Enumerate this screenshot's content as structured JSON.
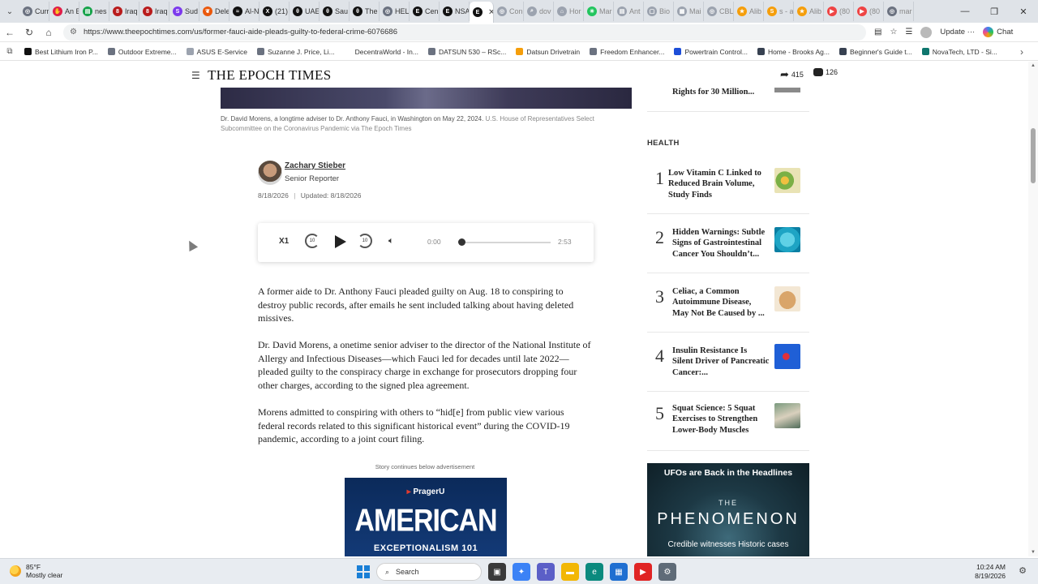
{
  "browser": {
    "tabs": [
      {
        "label": "Curr",
        "color": "#6b7280",
        "glyph": "◎"
      },
      {
        "label": "An E",
        "color": "#e11d48",
        "glyph": "✋"
      },
      {
        "label": "nes",
        "color": "#16a34a",
        "glyph": "▤"
      },
      {
        "label": "Iraq",
        "color": "#b91c1c",
        "glyph": "8"
      },
      {
        "label": "Iraq",
        "color": "#b91c1c",
        "glyph": "8"
      },
      {
        "label": "Sud",
        "color": "#7c3aed",
        "glyph": "S"
      },
      {
        "label": "Dele",
        "color": "#ea580c",
        "glyph": "❦"
      },
      {
        "label": "Al-N",
        "color": "#111111",
        "glyph": "≈"
      },
      {
        "label": "(21)",
        "color": "#111111",
        "glyph": "X"
      },
      {
        "label": "UAE",
        "color": "#111111",
        "glyph": "θ"
      },
      {
        "label": "Sau",
        "color": "#111111",
        "glyph": "θ"
      },
      {
        "label": "The",
        "color": "#111111",
        "glyph": "θ"
      },
      {
        "label": "HEL",
        "color": "#6b7280",
        "glyph": "◎"
      },
      {
        "label": "Cen",
        "color": "#111111",
        "glyph": "E"
      },
      {
        "label": "NSA",
        "color": "#111111",
        "glyph": "E"
      }
    ],
    "active_tab_glyph": "E",
    "dim_tabs": [
      {
        "label": "Con",
        "color": "#9ca3af",
        "glyph": "◎"
      },
      {
        "label": "dov",
        "color": "#9ca3af",
        "glyph": "⌕"
      },
      {
        "label": "Hor",
        "color": "#9ca3af",
        "glyph": "⌂"
      },
      {
        "label": "Mar",
        "color": "#22c55e",
        "glyph": "✳"
      },
      {
        "label": "Ant",
        "color": "#9ca3af",
        "glyph": "▤"
      },
      {
        "label": "Bio",
        "color": "#9ca3af",
        "glyph": "▢"
      },
      {
        "label": "Mai",
        "color": "#9ca3af",
        "glyph": "▦"
      },
      {
        "label": "CBL",
        "color": "#9ca3af",
        "glyph": "◎"
      },
      {
        "label": "Alib",
        "color": "#f59e0b",
        "glyph": "★"
      },
      {
        "label": "s - a",
        "color": "#f59e0b",
        "glyph": "S"
      },
      {
        "label": "Alib",
        "color": "#f59e0b",
        "glyph": "★"
      },
      {
        "label": "(80",
        "color": "#ef4444",
        "glyph": "▶"
      },
      {
        "label": "(80",
        "color": "#ef4444",
        "glyph": "▶"
      },
      {
        "label": "mar",
        "color": "#6b7280",
        "glyph": "◎"
      }
    ],
    "tab_close": "✕",
    "new_tab": "+",
    "url": "https://www.theepochtimes.com/us/former-fauci-aide-pleads-guilty-to-federal-crime-6076686",
    "update_label": "Update",
    "chat_label": "Chat",
    "bookmarks": [
      {
        "label": "Best Lithium Iron P...",
        "color": "#111111"
      },
      {
        "label": "Outdoor Extreme...",
        "color": "#6b7280"
      },
      {
        "label": "ASUS E-Service",
        "color": "#9ca3af"
      },
      {
        "label": "Suzanne J. Price, Li...",
        "color": "#6b7280"
      },
      {
        "label": "DecentraWorld - In...",
        "color": "#ffffff"
      },
      {
        "label": "DATSUN 530 – RSc...",
        "color": "#6b7280"
      },
      {
        "label": "Datsun Drivetrain",
        "color": "#f59e0b"
      },
      {
        "label": "Freedom Enhancer...",
        "color": "#6b7280"
      },
      {
        "label": "Powertrain Control...",
        "color": "#1d4ed8"
      },
      {
        "label": "Home - Brooks Ag...",
        "color": "#374151"
      },
      {
        "label": "Beginner's Guide t...",
        "color": "#374151"
      },
      {
        "label": "NovaTech, LTD - Si...",
        "color": "#0f766e"
      }
    ]
  },
  "header": {
    "logo": "THE EPOCH TIMES",
    "share_count": "415",
    "comment_count": "126"
  },
  "article": {
    "caption": "Dr. David Morens, a longtime adviser to Dr. Anthony Fauci, in Washington on May 22, 2024.",
    "caption_credit": "U.S. House of Representatives Select Subcommittee on the Coronavirus Pandemic via The Epoch Times",
    "author_name": "Zachary Stieber",
    "author_role": "Senior Reporter",
    "date_published": "8/18/2026",
    "date_updated": "Updated: 8/18/2026",
    "player": {
      "speed": "X1",
      "skip_back": "10",
      "skip_fwd": "10",
      "time_current": "0:00",
      "time_total": "2:53",
      "progress": 0
    },
    "paragraphs": [
      "A former aide to Dr. Anthony Fauci pleaded guilty on Aug. 18 to conspiring to destroy public records, after emails he sent included talking about having deleted missives.",
      "Dr. David Morens, a onetime senior adviser to the director of the National Institute of Allergy and Infectious Diseases—which Fauci led for decades until late 2022—pleaded guilty to the conspiracy charge in exchange for prosecutors dropping four other charges, according to the signed plea agreement.",
      "Morens admitted to conspiring with others to “hid[e] from public view various federal records related to this significant historical event” during the COVID-19 pandemic, according to a joint court filing."
    ],
    "ad_label": "Story continues below advertisement",
    "ad": {
      "brand_prefix": "▸",
      "brand": "PragerU",
      "title": "AMERICAN",
      "subtitle": "EXCEPTIONALISM 101"
    }
  },
  "rail": {
    "top_item": "Rights for 30 Million...",
    "section_label": "HEALTH",
    "items": [
      {
        "num": "1",
        "title": "Low Vitamin C Linked to Reduced Brain Volume, Study Finds"
      },
      {
        "num": "2",
        "title": "Hidden Warnings: Subtle Signs of Gastrointestinal Cancer You Shouldn’t..."
      },
      {
        "num": "3",
        "title": "Celiac, a Common Autoimmune Disease, May Not Be Caused by ..."
      },
      {
        "num": "4",
        "title": "Insulin Resistance Is Silent Driver of Pancreatic Cancer:..."
      },
      {
        "num": "5",
        "title": "Squat Science: 5 Squat Exercises to Strengthen Lower-Body Muscles"
      }
    ],
    "ad": {
      "headline": "UFOs are Back in the Headlines",
      "the": "THE",
      "title": "PHENOMENON",
      "sub": "Credible witnesses Historic cases"
    }
  },
  "taskbar": {
    "temp": "85°F",
    "condition": "Mostly clear",
    "search_label": "Search",
    "time": "10:24 AM",
    "date": "8/19/2026"
  }
}
